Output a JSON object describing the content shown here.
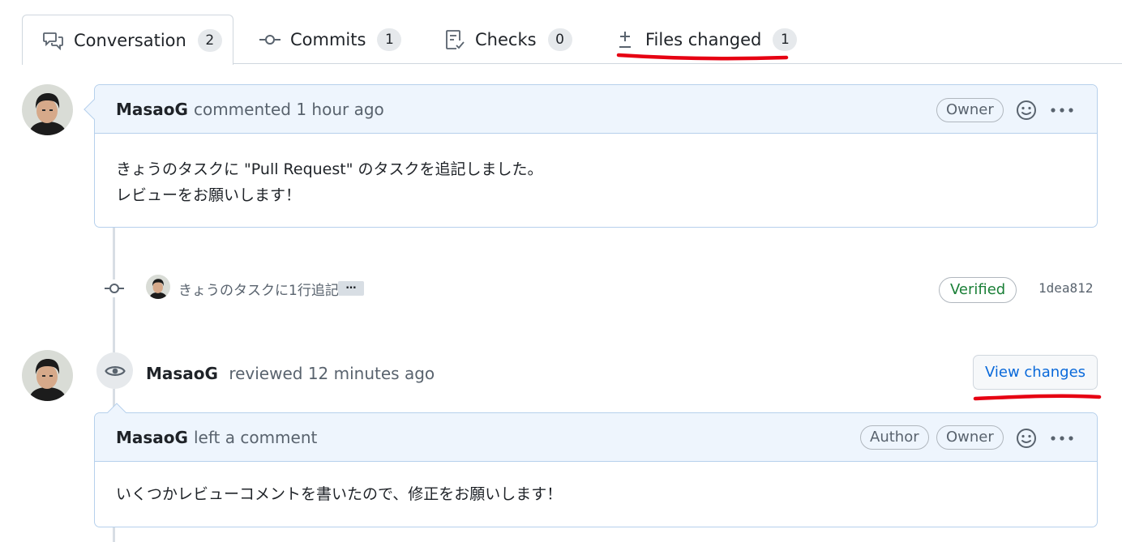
{
  "tabs": [
    {
      "label": "Conversation",
      "count": "2",
      "icon": "comment-discussion-icon"
    },
    {
      "label": "Commits",
      "count": "1",
      "icon": "git-commit-icon"
    },
    {
      "label": "Checks",
      "count": "0",
      "icon": "checklist-icon"
    },
    {
      "label": "Files changed",
      "count": "1",
      "icon": "file-diff-icon"
    }
  ],
  "comment1": {
    "author": "MasaoG",
    "action": "commented 1 hour ago",
    "badge": "Owner",
    "body_line1": "きょうのタスクに \"Pull Request\" のタスクを追記しました。",
    "body_line2": "レビューをお願いします！"
  },
  "commit": {
    "message": "きょうのタスクに1行追記",
    "ellipsis": "…",
    "verified": "Verified",
    "sha": "1dea812"
  },
  "review": {
    "author": "MasaoG",
    "action": "reviewed 12 minutes ago",
    "view_changes": "View changes"
  },
  "comment2": {
    "author": "MasaoG",
    "action": "left a comment",
    "badge_author": "Author",
    "badge_owner": "Owner",
    "body": "いくつかレビューコメントを書いたので、修正をお願いします！"
  },
  "colors": {
    "link": "#0969da",
    "verified": "#1a7f37",
    "annotation_red": "#e60012"
  }
}
